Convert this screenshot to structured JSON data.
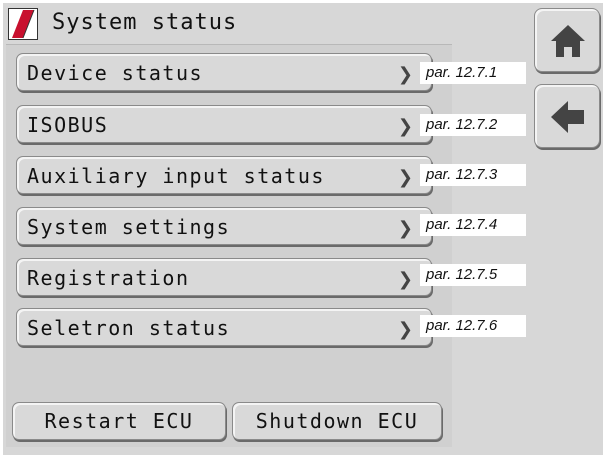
{
  "header": {
    "title": "System status",
    "logo_icon": "brand-logo-icon"
  },
  "menu": {
    "items": [
      {
        "label": "Device status",
        "ref": "par. 12.7.1"
      },
      {
        "label": "ISOBUS",
        "ref": "par. 12.7.2"
      },
      {
        "label": "Auxiliary input status",
        "ref": "par. 12.7.3"
      },
      {
        "label": "System settings",
        "ref": "par. 12.7.4"
      },
      {
        "label": "Registration",
        "ref": "par. 12.7.5"
      },
      {
        "label": "Seletron status",
        "ref": "par. 12.7.6"
      }
    ]
  },
  "footer": {
    "restart_label": "Restart ECU",
    "shutdown_label": "Shutdown ECU"
  },
  "nav": {
    "home_icon": "home-icon",
    "back_icon": "back-arrow-icon"
  },
  "colors": {
    "brand_red": "#c8102e",
    "screen_bg": "#d7d7d7"
  }
}
